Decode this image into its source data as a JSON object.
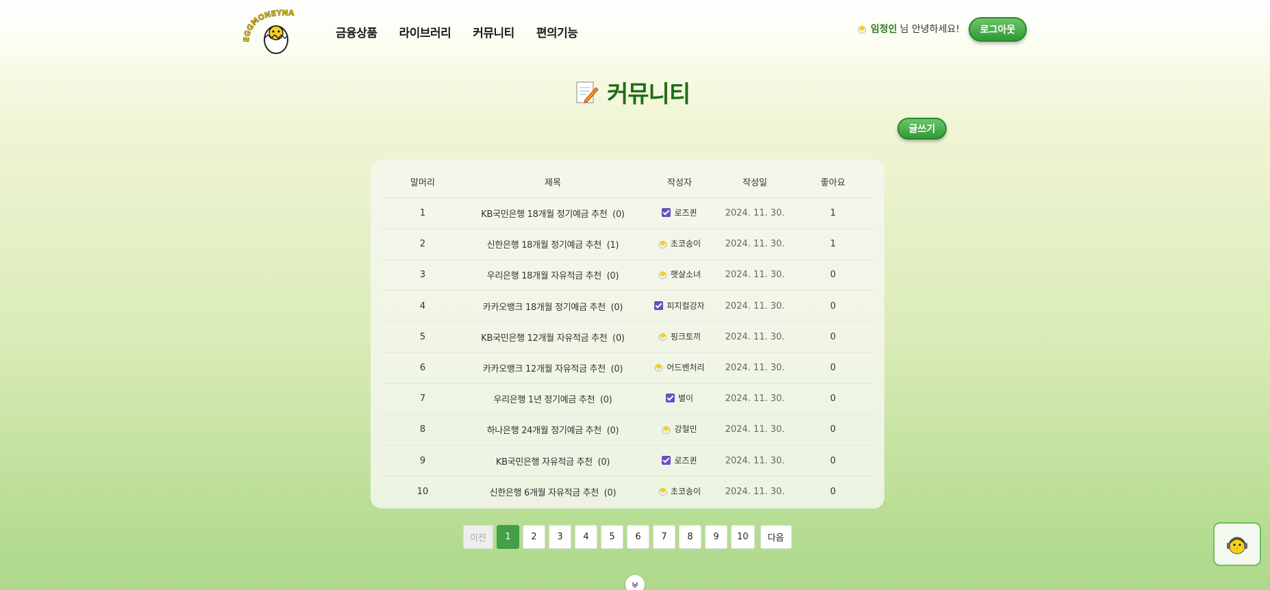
{
  "header": {
    "logo_text": "EGGMONEYNA",
    "nav": [
      "금융상품",
      "라이브러리",
      "커뮤니티",
      "편의기능"
    ],
    "user_name": "임정인",
    "greeting": "님 안녕하세요!",
    "logout_label": "로그아웃"
  },
  "page": {
    "title": "커뮤니티",
    "write_label": "글쓰기"
  },
  "table": {
    "columns": [
      "말머리",
      "제목",
      "작성자",
      "작성일",
      "좋아요"
    ],
    "rows": [
      {
        "no": "1",
        "title": "KB국민은행 18개월 정기예금 추천",
        "comments": "(0)",
        "badge": "check",
        "author": "로즈퀸",
        "date": "2024. 11. 30.",
        "likes": "1"
      },
      {
        "no": "2",
        "title": "신한은행 18개월 정기예금 추천",
        "comments": "(1)",
        "badge": "egg",
        "author": "초코송이",
        "date": "2024. 11. 30.",
        "likes": "1"
      },
      {
        "no": "3",
        "title": "우리은행 18개월 자유적금 추천",
        "comments": "(0)",
        "badge": "egg",
        "author": "햇살소녀",
        "date": "2024. 11. 30.",
        "likes": "0"
      },
      {
        "no": "4",
        "title": "카카오뱅크 18개월 정기예금 추천",
        "comments": "(0)",
        "badge": "check",
        "author": "피지컬강자",
        "date": "2024. 11. 30.",
        "likes": "0"
      },
      {
        "no": "5",
        "title": "KB국민은행 12개월 자유적금 추천",
        "comments": "(0)",
        "badge": "egg",
        "author": "핑크토끼",
        "date": "2024. 11. 30.",
        "likes": "0"
      },
      {
        "no": "6",
        "title": "카카오뱅크 12개월 자유적금 추천",
        "comments": "(0)",
        "badge": "egg",
        "author": "어드벤처리",
        "date": "2024. 11. 30.",
        "likes": "0"
      },
      {
        "no": "7",
        "title": "우리은행 1년 정기예금 추천",
        "comments": "(0)",
        "badge": "check",
        "author": "별이",
        "date": "2024. 11. 30.",
        "likes": "0"
      },
      {
        "no": "8",
        "title": "하나은행 24개월 정기예금 추천",
        "comments": "(0)",
        "badge": "egg",
        "author": "강철민",
        "date": "2024. 11. 30.",
        "likes": "0"
      },
      {
        "no": "9",
        "title": "KB국민은행 자유적금 추천",
        "comments": "(0)",
        "badge": "check",
        "author": "로즈퀸",
        "date": "2024. 11. 30.",
        "likes": "0"
      },
      {
        "no": "10",
        "title": "신한은행 6개월 자유적금 추천",
        "comments": "(0)",
        "badge": "egg",
        "author": "초코송이",
        "date": "2024. 11. 30.",
        "likes": "0"
      }
    ]
  },
  "pagination": {
    "prev_label": "이전",
    "next_label": "다음",
    "pages": [
      "1",
      "2",
      "3",
      "4",
      "5",
      "6",
      "7",
      "8",
      "9",
      "10"
    ],
    "current": "1"
  },
  "colors": {
    "brand_green": "#43a047",
    "title_green": "#1e6e16",
    "check_purple": "#6a4fc0"
  }
}
